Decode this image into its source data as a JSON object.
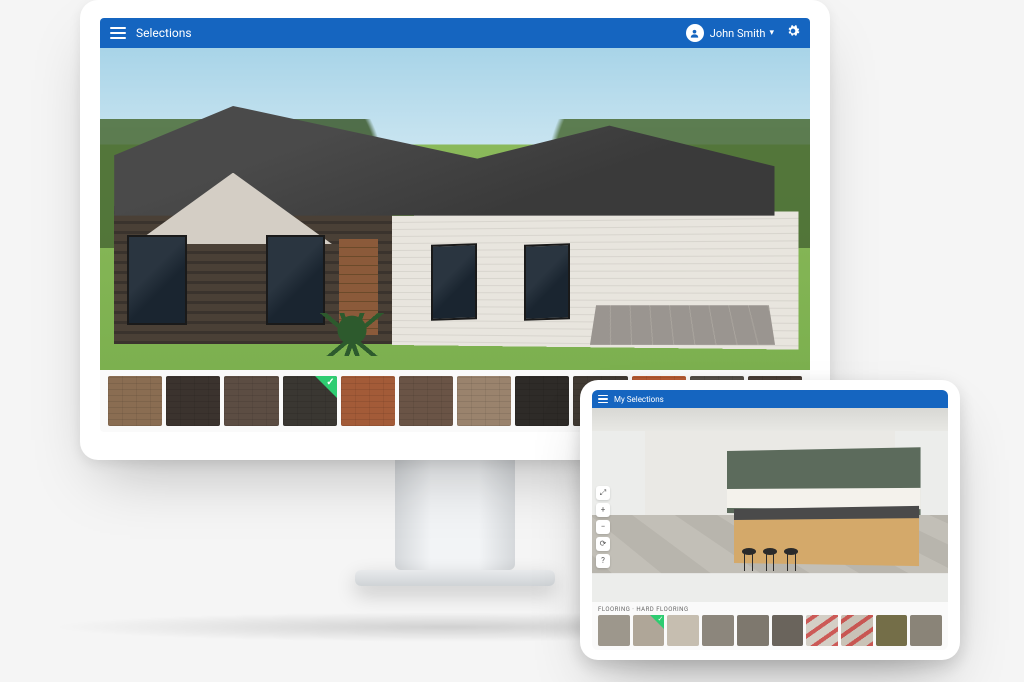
{
  "desktop": {
    "header": {
      "title": "Selections",
      "user_name": "John Smith"
    },
    "swatches": [
      {
        "color": "#8a6d52",
        "selected": false
      },
      {
        "color": "#3b332e",
        "selected": false
      },
      {
        "color": "#5c4d43",
        "selected": false
      },
      {
        "color": "#3a3732",
        "selected": true
      },
      {
        "color": "#a35b38",
        "selected": false
      },
      {
        "color": "#6a5446",
        "selected": false
      },
      {
        "color": "#9a836d",
        "selected": false
      },
      {
        "color": "#2e2b28",
        "selected": false
      },
      {
        "color": "#423b34",
        "selected": false
      },
      {
        "color": "#b85b32",
        "selected": false
      },
      {
        "color": "#555048",
        "selected": false
      },
      {
        "color": "#4a3e36",
        "selected": false
      }
    ]
  },
  "tablet": {
    "header": {
      "title": "My Selections"
    },
    "footer_label": "Flooring · Hard Flooring",
    "swatches": [
      {
        "color": "#9d978c",
        "selected": false,
        "diag": false
      },
      {
        "color": "#afa698",
        "selected": true,
        "diag": false
      },
      {
        "color": "#c6beb0",
        "selected": false,
        "diag": false
      },
      {
        "color": "#8c867c",
        "selected": false,
        "diag": false
      },
      {
        "color": "#7e786e",
        "selected": false,
        "diag": false
      },
      {
        "color": "#6a645c",
        "selected": false,
        "diag": false
      },
      {
        "color": "#d4cfc6",
        "selected": false,
        "diag": true
      },
      {
        "color": "#c9c2b6",
        "selected": false,
        "diag": true
      },
      {
        "color": "#746e48",
        "selected": false,
        "diag": false
      },
      {
        "color": "#8a8478",
        "selected": false,
        "diag": false
      }
    ],
    "toolbar_icons": [
      "⤢",
      "+",
      "−",
      "⟳",
      "?"
    ]
  }
}
